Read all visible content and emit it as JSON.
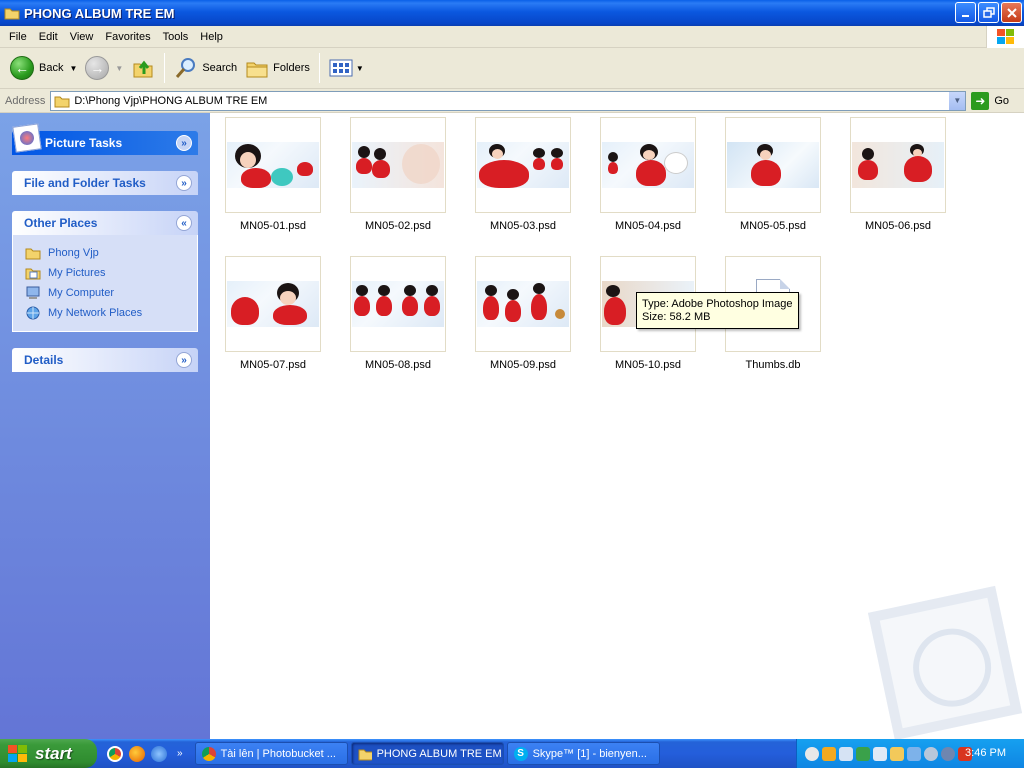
{
  "window": {
    "title": "PHONG ALBUM TRE EM",
    "controls": [
      "minimize",
      "maximize",
      "close"
    ]
  },
  "menu": [
    "File",
    "Edit",
    "View",
    "Favorites",
    "Tools",
    "Help"
  ],
  "toolbar": {
    "back_label": "Back",
    "search_label": "Search",
    "folders_label": "Folders"
  },
  "address": {
    "label": "Address",
    "path": "D:\\Phong Vjp\\PHONG ALBUM TRE EM",
    "go_label": "Go"
  },
  "taskpane": {
    "picture_tasks": "Picture Tasks",
    "file_folder_tasks": "File and Folder Tasks",
    "other_places": {
      "title": "Other Places",
      "items": [
        "Phong Vjp",
        "My Pictures",
        "My Computer",
        "My Network Places"
      ]
    },
    "details": "Details"
  },
  "files": [
    "MN05-01.psd",
    "MN05-02.psd",
    "MN05-03.psd",
    "MN05-04.psd",
    "MN05-05.psd",
    "MN05-06.psd",
    "MN05-07.psd",
    "MN05-08.psd",
    "MN05-09.psd",
    "MN05-10.psd",
    "Thumbs.db"
  ],
  "tooltip": {
    "type": "Type: Adobe Photoshop Image",
    "size": "Size: 58.2 MB"
  },
  "taskbar": {
    "start_label": "start",
    "buttons": [
      "Tài lên | Photobucket ...",
      "PHONG ALBUM TRE EM",
      "Skype™ [1] - bienyen..."
    ],
    "clock": "3:46 PM"
  },
  "colors": {
    "titlebar": "#0a58e0",
    "taskpane_top": "#7ba2e7",
    "taskpane_bottom": "#6375d6",
    "start_green": "#3a9a3a",
    "tooltip_bg": "#ffffe1"
  }
}
